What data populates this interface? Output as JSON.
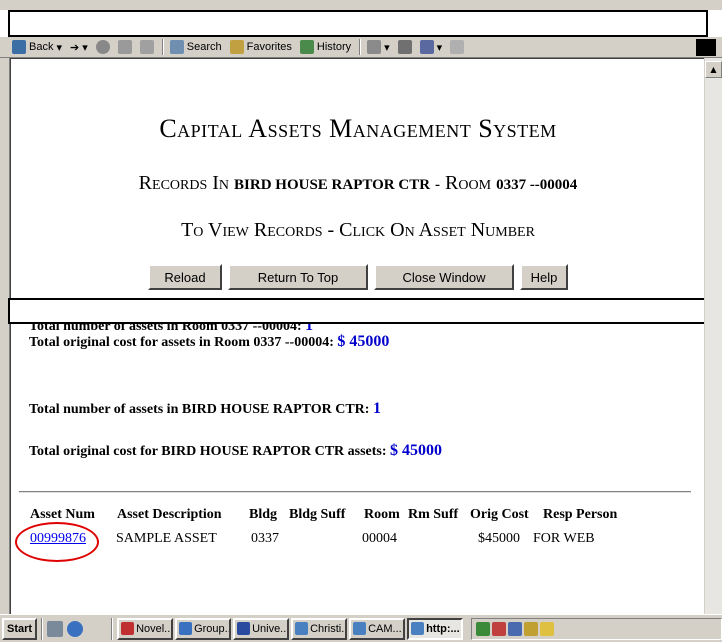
{
  "toolbar": {
    "back": "Back",
    "search": "Search",
    "favorites": "Favorites",
    "history": "History"
  },
  "page": {
    "title": "Capital Assets Management System",
    "subtitle_prefix": "Records In",
    "subtitle_building": "BIRD HOUSE RAPTOR CTR",
    "subtitle_dash": "-",
    "subtitle_room_word": "Room",
    "subtitle_room": "0337 --00004",
    "instruction": "To View Records - Click On Asset Number",
    "buttons": [
      "Reload",
      "Return To Top",
      "Close Window",
      "Help"
    ],
    "stats": [
      {
        "label": "Total number of assets in Room 0337 --00004:",
        "value": "1"
      },
      {
        "label": "Total original cost for assets in Room 0337 --00004:",
        "value": "$ 45000"
      },
      {
        "label": "Total number of assets in BIRD HOUSE RAPTOR CTR:",
        "value": "1"
      },
      {
        "label": "Total original cost for BIRD HOUSE RAPTOR CTR assets:",
        "value": "$ 45000"
      }
    ]
  },
  "table": {
    "headers": [
      "Asset Num",
      "Asset Description",
      "Bldg",
      "Bldg Suff",
      "Room",
      "Rm Suff",
      "Orig Cost",
      "Resp Person"
    ],
    "rows": [
      [
        "00999876",
        "SAMPLE ASSET",
        "0337",
        "",
        "00004",
        "",
        "$45000",
        "FOR WEB"
      ]
    ]
  },
  "taskbar": {
    "start": "Start",
    "tasks": [
      "Novel...",
      "Group...",
      "Unive...",
      "Christi...",
      "CAM...",
      "http:..."
    ]
  },
  "colors": {
    "link": "#0000ee",
    "value": "#0000cc",
    "annotation_circle": "#e00000",
    "chrome": "#d4d0c8"
  }
}
